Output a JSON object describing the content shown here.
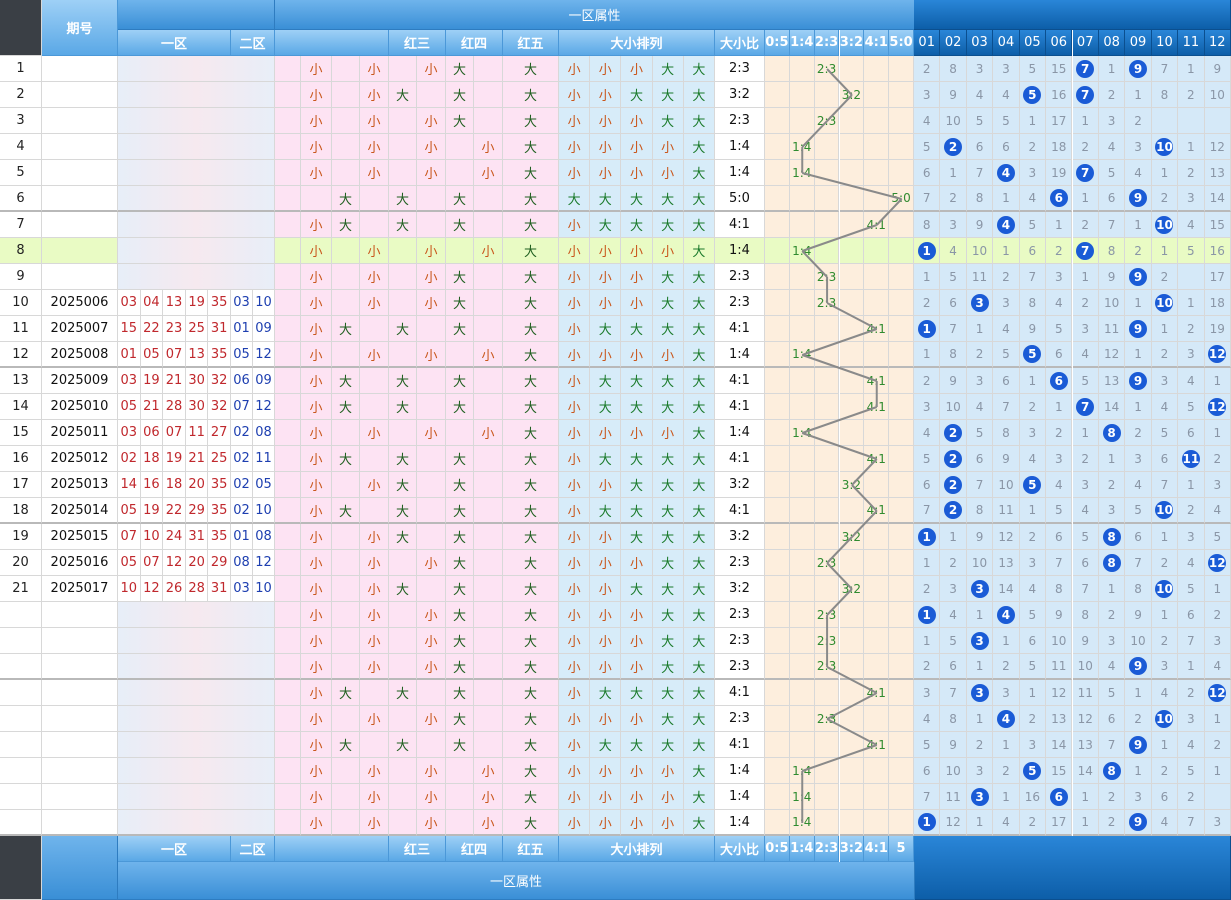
{
  "header": {
    "left_title": "期号",
    "group_label": "一区属性",
    "col_zone1": "一区",
    "col_zone2": "二区",
    "col_red3": "红三",
    "col_red4": "红四",
    "col_red5": "红五",
    "col_size_order": "大小排列",
    "col_size_ratio": "大小比",
    "ratio_labels": [
      "0:5",
      "1:4",
      "2:3",
      "3:2",
      "4:1",
      "5:0"
    ],
    "ratio_labels_footer": [
      "0:5",
      "1:4",
      "2:3",
      "3:2",
      "4:1",
      "5"
    ],
    "miss_labels": [
      "01",
      "02",
      "03",
      "04",
      "05",
      "06",
      "07",
      "08",
      "09",
      "10",
      "11",
      "12"
    ]
  },
  "rows": [
    {
      "seq": "1",
      "period": "",
      "reds": [],
      "blues": [],
      "pa": [
        "小",
        "",
        "小",
        "",
        "小",
        "大",
        "",
        "大"
      ],
      "sa": [
        "小",
        "小",
        "小",
        "大",
        "大"
      ],
      "ratio": "2:3",
      "ri": 2,
      "miss": [
        "2",
        "8",
        "3",
        "3",
        "5",
        "15",
        "7",
        "1",
        "9",
        "7",
        "1",
        "9"
      ],
      "hits": [
        6,
        8
      ]
    },
    {
      "seq": "2",
      "period": "",
      "reds": [],
      "blues": [],
      "pa": [
        "小",
        "",
        "小",
        "大",
        "",
        "大",
        "",
        "大"
      ],
      "sa": [
        "小",
        "小",
        "大",
        "大",
        "大"
      ],
      "ratio": "3:2",
      "ri": 3,
      "miss": [
        "3",
        "9",
        "4",
        "4",
        "5",
        "16",
        "7",
        "2",
        "1",
        "8",
        "2",
        "10"
      ],
      "hits": [
        4,
        6
      ]
    },
    {
      "seq": "3",
      "period": "",
      "reds": [],
      "blues": [],
      "pa": [
        "小",
        "",
        "小",
        "",
        "小",
        "大",
        "",
        "大"
      ],
      "sa": [
        "小",
        "小",
        "小",
        "大",
        "大"
      ],
      "ratio": "2:3",
      "ri": 2,
      "miss": [
        "4",
        "10",
        "5",
        "5",
        "1",
        "17",
        "1",
        "3",
        "2",
        "",
        "",
        ""
      ],
      "hits": []
    },
    {
      "seq": "4",
      "period": "",
      "reds": [],
      "blues": [],
      "pa": [
        "小",
        "",
        "小",
        "",
        "小",
        "",
        "小",
        "大"
      ],
      "sa": [
        "小",
        "小",
        "小",
        "小",
        "大"
      ],
      "ratio": "1:4",
      "ri": 1,
      "miss": [
        "5",
        "2",
        "6",
        "6",
        "2",
        "18",
        "2",
        "4",
        "3",
        "10",
        "1",
        "12"
      ],
      "hits": [
        1,
        9
      ]
    },
    {
      "seq": "5",
      "period": "",
      "reds": [],
      "blues": [],
      "pa": [
        "小",
        "",
        "小",
        "",
        "小",
        "",
        "小",
        "大"
      ],
      "sa": [
        "小",
        "小",
        "小",
        "小",
        "大"
      ],
      "ratio": "1:4",
      "ri": 1,
      "miss": [
        "6",
        "1",
        "7",
        "4",
        "3",
        "19",
        "7",
        "5",
        "4",
        "1",
        "2",
        "13"
      ],
      "hits": [
        3,
        6
      ]
    },
    {
      "seq": "6",
      "period": "",
      "reds": [],
      "blues": [],
      "pa": [
        "",
        "大",
        "",
        "大",
        "",
        "大",
        "",
        "大"
      ],
      "sa": [
        "大",
        "大",
        "大",
        "大",
        "大"
      ],
      "ratio": "5:0",
      "ri": 5,
      "miss": [
        "7",
        "2",
        "8",
        "1",
        "4",
        "6",
        "1",
        "6",
        "9",
        "2",
        "3",
        "14"
      ],
      "hits": [
        5,
        8
      ]
    },
    {
      "seq": "7",
      "period": "",
      "reds": [],
      "blues": [],
      "pa": [
        "小",
        "大",
        "",
        "大",
        "",
        "大",
        "",
        "大"
      ],
      "sa": [
        "小",
        "大",
        "大",
        "大",
        "大"
      ],
      "ratio": "4:1",
      "ri": 4,
      "miss": [
        "8",
        "3",
        "9",
        "4",
        "5",
        "1",
        "2",
        "7",
        "1",
        "10",
        "4",
        "15"
      ],
      "hits": [
        3,
        9
      ]
    },
    {
      "seq": "8",
      "period": "",
      "reds": [],
      "blues": [],
      "pa": [
        "小",
        "",
        "小",
        "",
        "小",
        "",
        "小",
        "大"
      ],
      "sa": [
        "小",
        "小",
        "小",
        "小",
        "大"
      ],
      "ratio": "1:4",
      "ri": 1,
      "miss": [
        "1",
        "4",
        "10",
        "1",
        "6",
        "2",
        "7",
        "8",
        "2",
        "1",
        "5",
        "16"
      ],
      "hits": [
        0,
        6
      ]
    },
    {
      "seq": "9",
      "period": "",
      "reds": [],
      "blues": [],
      "pa": [
        "小",
        "",
        "小",
        "",
        "小",
        "大",
        "",
        "大"
      ],
      "sa": [
        "小",
        "小",
        "小",
        "大",
        "大"
      ],
      "ratio": "2:3",
      "ri": 2,
      "miss": [
        "1",
        "5",
        "11",
        "2",
        "7",
        "3",
        "1",
        "9",
        "9",
        "2",
        "",
        "17"
      ],
      "hits": [
        8
      ]
    },
    {
      "seq": "10",
      "period": "2025006",
      "reds": [
        "03",
        "04",
        "13",
        "19",
        "35"
      ],
      "blues": [
        "03",
        "10"
      ],
      "pa": [
        "小",
        "",
        "小",
        "",
        "小",
        "大",
        "",
        "大"
      ],
      "sa": [
        "小",
        "小",
        "小",
        "大",
        "大"
      ],
      "ratio": "2:3",
      "ri": 2,
      "miss": [
        "2",
        "6",
        "3",
        "3",
        "8",
        "4",
        "2",
        "10",
        "1",
        "10",
        "1",
        "18"
      ],
      "hits": [
        2,
        9
      ]
    },
    {
      "seq": "11",
      "period": "2025007",
      "reds": [
        "15",
        "22",
        "23",
        "25",
        "31"
      ],
      "blues": [
        "01",
        "09"
      ],
      "pa": [
        "小",
        "大",
        "",
        "大",
        "",
        "大",
        "",
        "大"
      ],
      "sa": [
        "小",
        "大",
        "大",
        "大",
        "大"
      ],
      "ratio": "4:1",
      "ri": 4,
      "miss": [
        "1",
        "7",
        "1",
        "4",
        "9",
        "5",
        "3",
        "11",
        "9",
        "1",
        "2",
        "19"
      ],
      "hits": [
        0,
        8
      ]
    },
    {
      "seq": "12",
      "period": "2025008",
      "reds": [
        "01",
        "05",
        "07",
        "13",
        "35"
      ],
      "blues": [
        "05",
        "12"
      ],
      "pa": [
        "小",
        "",
        "小",
        "",
        "小",
        "",
        "小",
        "大"
      ],
      "sa": [
        "小",
        "小",
        "小",
        "小",
        "大"
      ],
      "ratio": "1:4",
      "ri": 1,
      "miss": [
        "1",
        "8",
        "2",
        "5",
        "5",
        "6",
        "4",
        "12",
        "1",
        "2",
        "3",
        "12"
      ],
      "hits": [
        4,
        11
      ]
    },
    {
      "seq": "13",
      "period": "2025009",
      "reds": [
        "03",
        "19",
        "21",
        "30",
        "32"
      ],
      "blues": [
        "06",
        "09"
      ],
      "pa": [
        "小",
        "大",
        "",
        "大",
        "",
        "大",
        "",
        "大"
      ],
      "sa": [
        "小",
        "大",
        "大",
        "大",
        "大"
      ],
      "ratio": "4:1",
      "ri": 4,
      "miss": [
        "2",
        "9",
        "3",
        "6",
        "1",
        "6",
        "5",
        "13",
        "9",
        "3",
        "4",
        "1"
      ],
      "hits": [
        5,
        8
      ]
    },
    {
      "seq": "14",
      "period": "2025010",
      "reds": [
        "05",
        "21",
        "28",
        "30",
        "32"
      ],
      "blues": [
        "07",
        "12"
      ],
      "pa": [
        "小",
        "大",
        "",
        "大",
        "",
        "大",
        "",
        "大"
      ],
      "sa": [
        "小",
        "大",
        "大",
        "大",
        "大"
      ],
      "ratio": "4:1",
      "ri": 4,
      "miss": [
        "3",
        "10",
        "4",
        "7",
        "2",
        "1",
        "7",
        "14",
        "1",
        "4",
        "5",
        "12"
      ],
      "hits": [
        6,
        11
      ]
    },
    {
      "seq": "15",
      "period": "2025011",
      "reds": [
        "03",
        "06",
        "07",
        "11",
        "27"
      ],
      "blues": [
        "02",
        "08"
      ],
      "pa": [
        "小",
        "",
        "小",
        "",
        "小",
        "",
        "小",
        "大"
      ],
      "sa": [
        "小",
        "小",
        "小",
        "小",
        "大"
      ],
      "ratio": "1:4",
      "ri": 1,
      "miss": [
        "4",
        "2",
        "5",
        "8",
        "3",
        "2",
        "1",
        "8",
        "2",
        "5",
        "6",
        "1"
      ],
      "hits": [
        1,
        7
      ]
    },
    {
      "seq": "16",
      "period": "2025012",
      "reds": [
        "02",
        "18",
        "19",
        "21",
        "25"
      ],
      "blues": [
        "02",
        "11"
      ],
      "pa": [
        "小",
        "大",
        "",
        "大",
        "",
        "大",
        "",
        "大"
      ],
      "sa": [
        "小",
        "大",
        "大",
        "大",
        "大"
      ],
      "ratio": "4:1",
      "ri": 4,
      "miss": [
        "5",
        "2",
        "6",
        "9",
        "4",
        "3",
        "2",
        "1",
        "3",
        "6",
        "11",
        "2"
      ],
      "hits": [
        1,
        10
      ]
    },
    {
      "seq": "17",
      "period": "2025013",
      "reds": [
        "14",
        "16",
        "18",
        "20",
        "35"
      ],
      "blues": [
        "02",
        "05"
      ],
      "pa": [
        "小",
        "",
        "小",
        "大",
        "",
        "大",
        "",
        "大"
      ],
      "sa": [
        "小",
        "小",
        "大",
        "大",
        "大"
      ],
      "ratio": "3:2",
      "ri": 3,
      "miss": [
        "6",
        "2",
        "7",
        "10",
        "5",
        "4",
        "3",
        "2",
        "4",
        "7",
        "1",
        "3"
      ],
      "hits": [
        1,
        4
      ]
    },
    {
      "seq": "18",
      "period": "2025014",
      "reds": [
        "05",
        "19",
        "22",
        "29",
        "35"
      ],
      "blues": [
        "02",
        "10"
      ],
      "pa": [
        "小",
        "大",
        "",
        "大",
        "",
        "大",
        "",
        "大"
      ],
      "sa": [
        "小",
        "大",
        "大",
        "大",
        "大"
      ],
      "ratio": "4:1",
      "ri": 4,
      "miss": [
        "7",
        "2",
        "8",
        "11",
        "1",
        "5",
        "4",
        "3",
        "5",
        "10",
        "2",
        "4"
      ],
      "hits": [
        1,
        9
      ]
    },
    {
      "seq": "19",
      "period": "2025015",
      "reds": [
        "07",
        "10",
        "24",
        "31",
        "35"
      ],
      "blues": [
        "01",
        "08"
      ],
      "pa": [
        "小",
        "",
        "小",
        "大",
        "",
        "大",
        "",
        "大"
      ],
      "sa": [
        "小",
        "小",
        "大",
        "大",
        "大"
      ],
      "ratio": "3:2",
      "ri": 3,
      "miss": [
        "1",
        "1",
        "9",
        "12",
        "2",
        "6",
        "5",
        "8",
        "6",
        "1",
        "3",
        "5"
      ],
      "hits": [
        0,
        7
      ]
    },
    {
      "seq": "20",
      "period": "2025016",
      "reds": [
        "05",
        "07",
        "12",
        "20",
        "29"
      ],
      "blues": [
        "08",
        "12"
      ],
      "pa": [
        "小",
        "",
        "小",
        "",
        "小",
        "大",
        "",
        "大"
      ],
      "sa": [
        "小",
        "小",
        "小",
        "大",
        "大"
      ],
      "ratio": "2:3",
      "ri": 2,
      "miss": [
        "1",
        "2",
        "10",
        "13",
        "3",
        "7",
        "6",
        "8",
        "7",
        "2",
        "4",
        "12"
      ],
      "hits": [
        7,
        11
      ]
    },
    {
      "seq": "21",
      "period": "2025017",
      "reds": [
        "10",
        "12",
        "26",
        "28",
        "31"
      ],
      "blues": [
        "03",
        "10"
      ],
      "pa": [
        "小",
        "",
        "小",
        "大",
        "",
        "大",
        "",
        "大"
      ],
      "sa": [
        "小",
        "小",
        "大",
        "大",
        "大"
      ],
      "ratio": "3:2",
      "ri": 3,
      "miss": [
        "2",
        "3",
        "3",
        "14",
        "4",
        "8",
        "7",
        "1",
        "8",
        "10",
        "5",
        "1"
      ],
      "hits": [
        2,
        9
      ]
    },
    {
      "seq": "",
      "period": "",
      "reds": [],
      "blues": [],
      "pa": [
        "小",
        "",
        "小",
        "",
        "小",
        "大",
        "",
        "大"
      ],
      "sa": [
        "小",
        "小",
        "小",
        "大",
        "大"
      ],
      "ratio": "2:3",
      "ri": 2,
      "miss": [
        "1",
        "4",
        "1",
        "4",
        "5",
        "9",
        "8",
        "2",
        "9",
        "1",
        "6",
        "2"
      ],
      "hits": [
        0,
        3
      ]
    },
    {
      "seq": "",
      "period": "",
      "reds": [],
      "blues": [],
      "pa": [
        "小",
        "",
        "小",
        "",
        "小",
        "大",
        "",
        "大"
      ],
      "sa": [
        "小",
        "小",
        "小",
        "大",
        "大"
      ],
      "ratio": "2:3",
      "ri": 2,
      "miss": [
        "1",
        "5",
        "3",
        "1",
        "6",
        "10",
        "9",
        "3",
        "10",
        "2",
        "7",
        "3"
      ],
      "hits": [
        2
      ]
    },
    {
      "seq": "",
      "period": "",
      "reds": [],
      "blues": [],
      "pa": [
        "小",
        "",
        "小",
        "",
        "小",
        "大",
        "",
        "大"
      ],
      "sa": [
        "小",
        "小",
        "小",
        "大",
        "大"
      ],
      "ratio": "2:3",
      "ri": 2,
      "miss": [
        "2",
        "6",
        "1",
        "2",
        "5",
        "11",
        "10",
        "4",
        "9",
        "3",
        "1",
        "4"
      ],
      "hits": [
        8
      ]
    },
    {
      "seq": "",
      "period": "",
      "reds": [],
      "blues": [],
      "pa": [
        "小",
        "大",
        "",
        "大",
        "",
        "大",
        "",
        "大"
      ],
      "sa": [
        "小",
        "大",
        "大",
        "大",
        "大"
      ],
      "ratio": "4:1",
      "ri": 4,
      "miss": [
        "3",
        "7",
        "3",
        "3",
        "1",
        "12",
        "11",
        "5",
        "1",
        "4",
        "2",
        "12"
      ],
      "hits": [
        2,
        11
      ]
    },
    {
      "seq": "",
      "period": "",
      "reds": [],
      "blues": [],
      "pa": [
        "小",
        "",
        "小",
        "",
        "小",
        "大",
        "",
        "大"
      ],
      "sa": [
        "小",
        "小",
        "小",
        "大",
        "大"
      ],
      "ratio": "2:3",
      "ri": 2,
      "miss": [
        "4",
        "8",
        "1",
        "4",
        "2",
        "13",
        "12",
        "6",
        "2",
        "10",
        "3",
        "1"
      ],
      "hits": [
        3,
        9
      ]
    },
    {
      "seq": "",
      "period": "",
      "reds": [],
      "blues": [],
      "pa": [
        "小",
        "大",
        "",
        "大",
        "",
        "大",
        "",
        "大"
      ],
      "sa": [
        "小",
        "大",
        "大",
        "大",
        "大"
      ],
      "ratio": "4:1",
      "ri": 4,
      "miss": [
        "5",
        "9",
        "2",
        "1",
        "3",
        "14",
        "13",
        "7",
        "9",
        "1",
        "4",
        "2"
      ],
      "hits": [
        8
      ]
    },
    {
      "seq": "",
      "period": "",
      "reds": [],
      "blues": [],
      "pa": [
        "小",
        "",
        "小",
        "",
        "小",
        "",
        "小",
        "大"
      ],
      "sa": [
        "小",
        "小",
        "小",
        "小",
        "大"
      ],
      "ratio": "1:4",
      "ri": 1,
      "miss": [
        "6",
        "10",
        "3",
        "2",
        "5",
        "15",
        "14",
        "8",
        "1",
        "2",
        "5",
        "1"
      ],
      "hits": [
        4,
        7
      ]
    },
    {
      "seq": "",
      "period": "",
      "reds": [],
      "blues": [],
      "pa": [
        "小",
        "",
        "小",
        "",
        "小",
        "",
        "小",
        "大"
      ],
      "sa": [
        "小",
        "小",
        "小",
        "小",
        "大"
      ],
      "ratio": "1:4",
      "ri": 1,
      "miss": [
        "7",
        "11",
        "3",
        "1",
        "16",
        "7",
        "1",
        "2",
        "3",
        "6",
        "2",
        ""
      ],
      "hits": [
        2,
        5
      ]
    },
    {
      "seq": "",
      "period": "",
      "reds": [],
      "blues": [],
      "pa": [
        "小",
        "",
        "小",
        "",
        "小",
        "",
        "小",
        "大"
      ],
      "sa": [
        "小",
        "小",
        "小",
        "小",
        "大"
      ],
      "ratio": "1:4",
      "ri": 1,
      "miss": [
        "1",
        "12",
        "1",
        "4",
        "2",
        "17",
        "1",
        "2",
        "9",
        "4",
        "7",
        "3"
      ],
      "hits": [
        0,
        8
      ]
    }
  ]
}
